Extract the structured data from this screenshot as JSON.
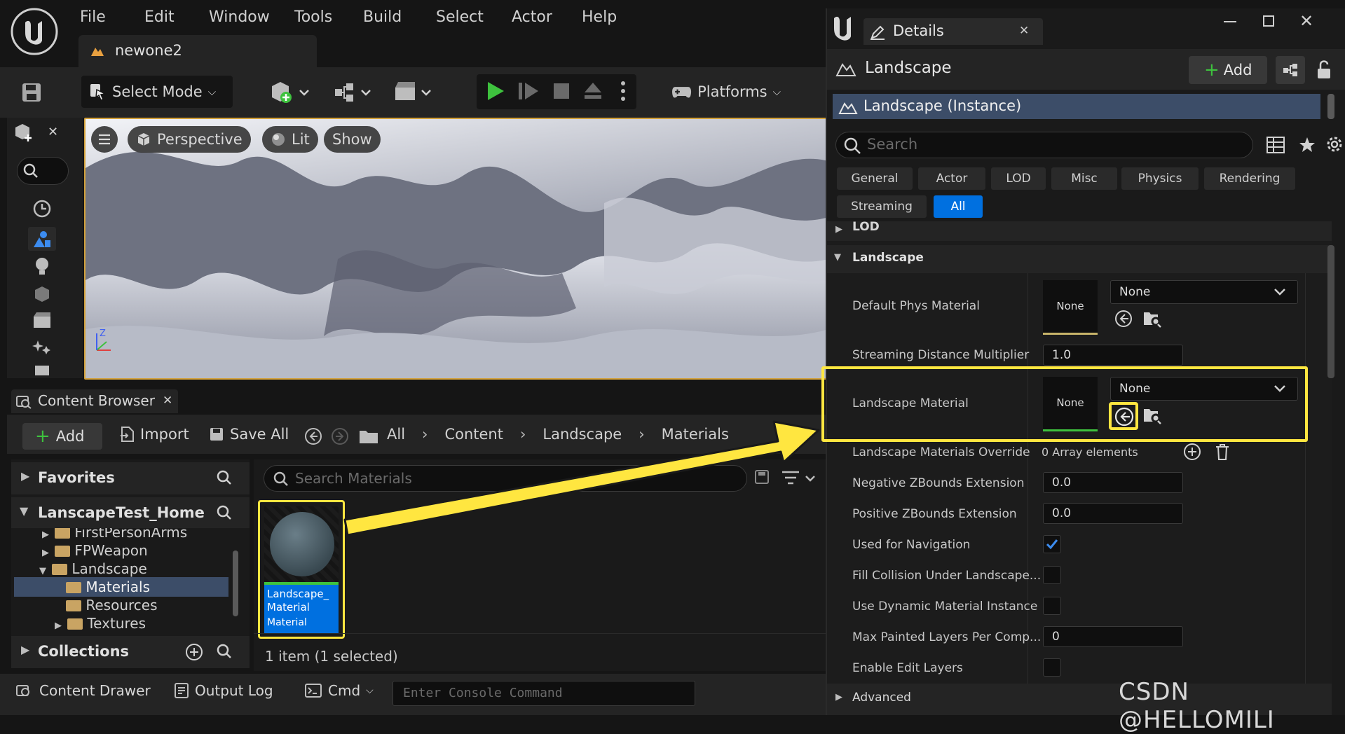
{
  "menu": {
    "items": [
      "File",
      "Edit",
      "Window",
      "Tools",
      "Build",
      "Select",
      "Actor",
      "Help"
    ]
  },
  "doc_tab": {
    "label": "newone2"
  },
  "toolbar": {
    "select_mode": "Select Mode",
    "platforms": "Platforms"
  },
  "viewport": {
    "perspective": "Perspective",
    "lit": "Lit",
    "show": "Show",
    "axis_z": "Z"
  },
  "content_browser": {
    "tab_label": "Content Browser",
    "add": "Add",
    "import": "Import",
    "save_all": "Save All",
    "breadcrumb": [
      "All",
      "Content",
      "Landscape",
      "Materials"
    ],
    "favorites": "Favorites",
    "project": "LanscapeTest_Home",
    "tree": [
      {
        "label": "FirstPersonArms",
        "level": 1
      },
      {
        "label": "FPWeapon",
        "level": 1
      },
      {
        "label": "Landscape",
        "level": 1,
        "open": true
      },
      {
        "label": "Materials",
        "level": 2,
        "selected": true
      },
      {
        "label": "Resources",
        "level": 2
      },
      {
        "label": "Textures",
        "level": 2
      }
    ],
    "collections": "Collections",
    "search_placeholder": "Search Materials",
    "asset": {
      "name": "Landscape_ Material",
      "type": "Material"
    },
    "status": "1 item (1 selected)"
  },
  "statusbar": {
    "content_drawer": "Content Drawer",
    "output_log": "Output Log",
    "cmd": "Cmd",
    "console_placeholder": "Enter Console Command"
  },
  "details": {
    "tab_label": "Details",
    "actor_name": "Landscape",
    "add": "Add",
    "instance": "Landscape (Instance)",
    "search_placeholder": "Search",
    "filters_row1": [
      "General",
      "Actor",
      "LOD",
      "Misc",
      "Physics",
      "Rendering"
    ],
    "filters_row2": [
      "Streaming",
      "All"
    ],
    "active_filter": "All",
    "section_lod": "LOD",
    "section_landscape": "Landscape",
    "section_advanced": "Advanced",
    "props": {
      "default_phys_material": {
        "label": "Default Phys Material",
        "thumb": "None",
        "value": "None"
      },
      "streaming_distance": {
        "label": "Streaming Distance Multiplier",
        "value": "1.0"
      },
      "landscape_material": {
        "label": "Landscape Material",
        "thumb": "None",
        "value": "None"
      },
      "materials_override": {
        "label": "Landscape Materials Override",
        "value": "0 Array elements"
      },
      "neg_zbounds": {
        "label": "Negative ZBounds Extension",
        "value": "0.0"
      },
      "pos_zbounds": {
        "label": "Positive ZBounds Extension",
        "value": "0.0"
      },
      "used_for_navigation": {
        "label": "Used for Navigation",
        "checked": true
      },
      "fill_collision": {
        "label": "Fill Collision Under Landscape...",
        "checked": false
      },
      "dynamic_material": {
        "label": "Use Dynamic Material Instance",
        "checked": false
      },
      "max_painted_layers": {
        "label": "Max Painted Layers Per Comp...",
        "value": "0"
      },
      "enable_edit_layers": {
        "label": "Enable Edit Layers",
        "checked": false
      }
    }
  },
  "watermark": "CSDN @HELLOMILI",
  "colors": {
    "highlight": "#ffe640",
    "accent_blue": "#0070e0",
    "play_green": "#3ec23e",
    "selection": "#3c4d68"
  }
}
